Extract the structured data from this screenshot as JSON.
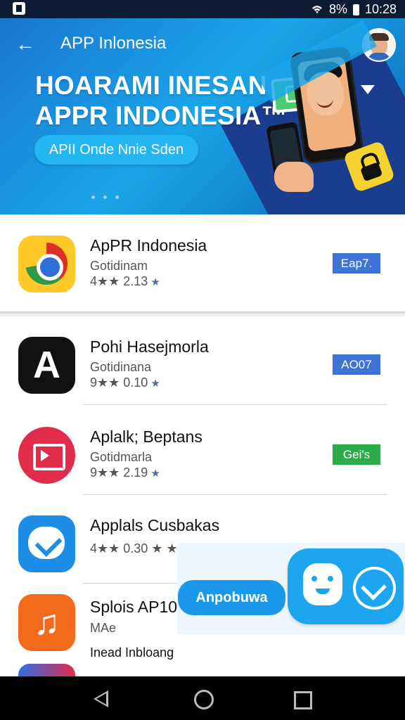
{
  "status": {
    "right_text": "8%",
    "time": "10:28"
  },
  "header": {
    "back_icon": "arrow-left-icon",
    "title": "APP Inlonesia",
    "headline_line1": "HOARAMI INESAN",
    "headline_line2": "APPR INDONESIA™",
    "cta": "APII Onde Nnie Sden"
  },
  "featured_app": {
    "name": "ApPR Indonesia",
    "subtitle": "Gotidinam",
    "rating": "4★★ 2.13",
    "rating_star": "★",
    "button": "Eap7.",
    "button_color": "#3f73d8"
  },
  "apps": [
    {
      "name": "Pohi Hasejmorla",
      "subtitle": "Gotidinana",
      "rating": "9★★ 0.10",
      "rating_star": "★",
      "button": "AO07",
      "button_color": "#3f73d8",
      "icon": "black-a-icon"
    },
    {
      "name": "Aplalk; Beptans",
      "subtitle": "Gotidmarla",
      "rating": "9★★ 2.19",
      "rating_star": "★",
      "button": "Gei's",
      "button_color": "#2cab48",
      "icon": "red-video-icon"
    },
    {
      "name": "Applals Cusbakas",
      "rating": "4★★ 0.30 ★ ★",
      "icon": "blue-message-icon"
    },
    {
      "name": "Splois AP10",
      "subtitle": "MAe",
      "secondary": "Inead Inbloang",
      "icon": "orange-music-icon"
    }
  ],
  "floating": {
    "label": "Anpobuwa",
    "icons": [
      "android-robot-icon",
      "shield-icon"
    ]
  },
  "navigation": {
    "back": "back-triangle-icon",
    "home": "home-circle-icon",
    "recent": "recent-square-icon"
  }
}
